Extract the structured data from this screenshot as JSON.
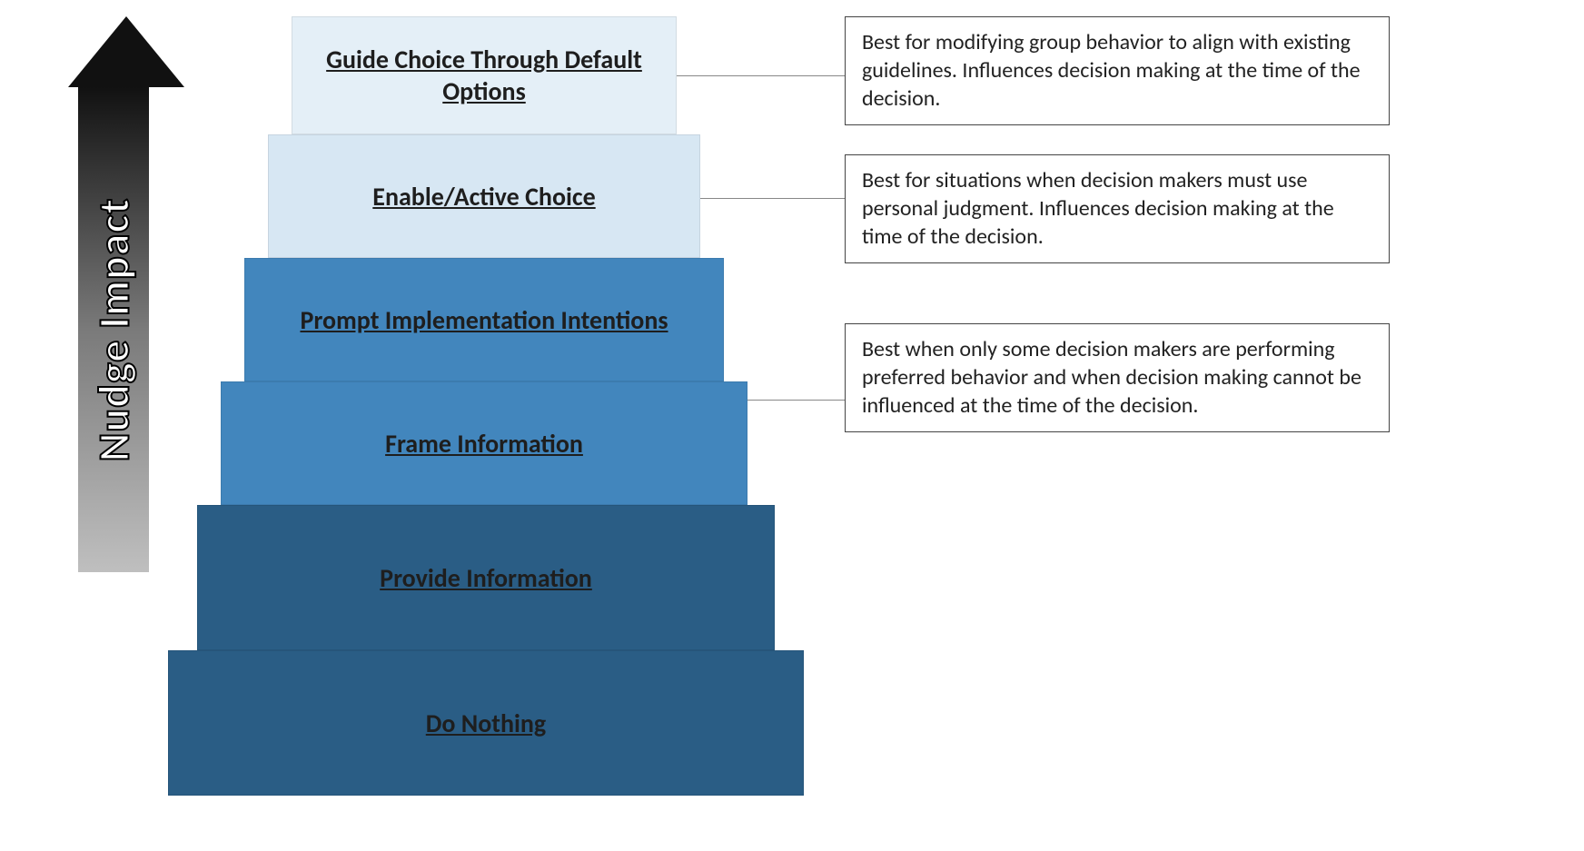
{
  "axis_label": "Nudge Impact",
  "levels": [
    {
      "id": "guide-defaults",
      "label": "Guide Choice Through Default Options",
      "color_group": "lightest"
    },
    {
      "id": "active-choice",
      "label": "Enable/Active Choice",
      "color_group": "lightest"
    },
    {
      "id": "prompt-intent",
      "label": "Prompt Implementation Intentions",
      "color_group": "mid"
    },
    {
      "id": "frame-info",
      "label": "Frame Information",
      "color_group": "mid"
    },
    {
      "id": "provide-info",
      "label": "Provide Information",
      "color_group": "dark"
    },
    {
      "id": "do-nothing",
      "label": "Do Nothing",
      "color_group": "dark"
    }
  ],
  "callouts": [
    {
      "id": "co-defaults",
      "text": "Best for modifying group behavior to align with existing guidelines. Influences decision making at the time of the decision.",
      "points_to": "guide-defaults"
    },
    {
      "id": "co-active",
      "text": "Best for situations when decision makers must use personal judgment. Influences decision making at the time of the decision.",
      "points_to": "active-choice"
    },
    {
      "id": "co-bottom",
      "text": "Best when only some decision makers are performing preferred behavior and when decision making cannot be influenced at the time of the decision.",
      "points_to": [
        "prompt-intent",
        "frame-info",
        "provide-info",
        "do-nothing"
      ]
    }
  ],
  "colors": {
    "lightest": "#e4eff7",
    "light": "#d7e7f3",
    "mid": "#4286bd",
    "dark": "#2a5d85",
    "arrow_top": "#111111",
    "arrow_bot": "#bfbfbf"
  }
}
